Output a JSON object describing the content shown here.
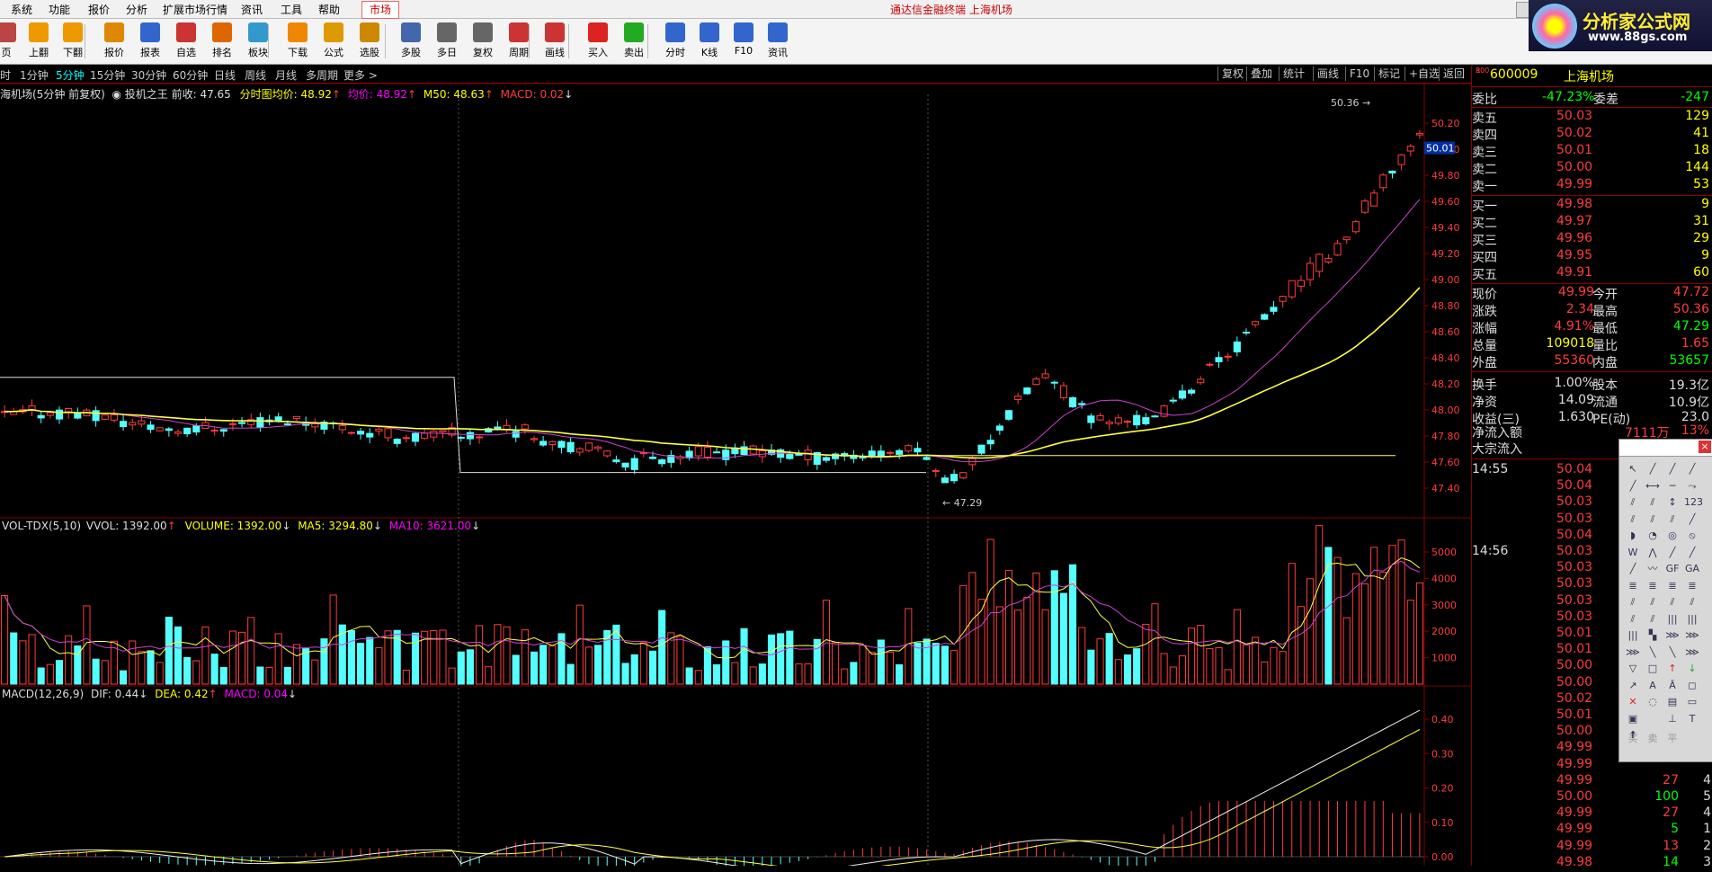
{
  "menubar": {
    "items": [
      "系统",
      "功能",
      "报价",
      "分析",
      "扩展市场行情",
      "资讯",
      "工具",
      "帮助"
    ],
    "market_tab": "市场",
    "app_title": "通达信金融终端  上海机场"
  },
  "toolbar": {
    "buttons": [
      {
        "label": "页",
        "icon": "page-icon",
        "color": "#b44"
      },
      {
        "label": "上翻",
        "icon": "arrow-up-icon",
        "color": "#e90"
      },
      {
        "label": "下翻",
        "icon": "arrow-down-icon",
        "color": "#e90"
      },
      {
        "label": "报价",
        "icon": "yen-icon",
        "color": "#d80"
      },
      {
        "label": "报表",
        "icon": "report-icon",
        "color": "#36c"
      },
      {
        "label": "自选",
        "icon": "f6-key-icon",
        "color": "#c33"
      },
      {
        "label": "排名",
        "icon": "ranking-icon",
        "color": "#d60"
      },
      {
        "label": "板块",
        "icon": "blocks-icon",
        "color": "#39c"
      },
      {
        "label": "下载",
        "icon": "download-icon",
        "color": "#e80"
      },
      {
        "label": "公式",
        "icon": "formula-icon",
        "color": "#d90"
      },
      {
        "label": "选股",
        "icon": "stock-pick-icon",
        "color": "#c80"
      },
      {
        "label": "多股",
        "icon": "multi-stock-icon",
        "color": "#46a"
      },
      {
        "label": "多日",
        "icon": "clock-icon",
        "color": "#666"
      },
      {
        "label": "复权",
        "icon": "restore-icon",
        "color": "#666"
      },
      {
        "label": "周期",
        "icon": "f8-key-icon",
        "color": "#c33"
      },
      {
        "label": "画线",
        "icon": "pencil-icon",
        "color": "#c33"
      },
      {
        "label": "买入",
        "icon": "buy-icon",
        "color": "#d22"
      },
      {
        "label": "卖出",
        "icon": "sell-icon",
        "color": "#2a2"
      },
      {
        "label": "分时",
        "icon": "intraday-icon",
        "color": "#36c"
      },
      {
        "label": "K线",
        "icon": "kline-icon",
        "color": "#36c"
      },
      {
        "label": "F10",
        "icon": "f10-icon",
        "color": "#36c"
      },
      {
        "label": "资讯",
        "icon": "news-icon",
        "color": "#36c"
      }
    ]
  },
  "logo": {
    "title": "分析家公式网",
    "url_text": "www.88gs.com"
  },
  "periods": {
    "items": [
      "时",
      "1分钟",
      "5分钟",
      "15分钟",
      "30分钟",
      "60分钟",
      "日线",
      "周线",
      "月线",
      "多周期",
      "更多"
    ],
    "active": "5分钟",
    "right_tabs": [
      "复权",
      "叠加",
      "统计",
      "画线",
      "F10",
      "标记",
      "+自选",
      "返回"
    ]
  },
  "main_header": {
    "stock": "海机场(5分钟 前复权)",
    "indicator": "投机之王",
    "prev_close": "前收: 47.65",
    "avg_line": "分时图均价: 48.92",
    "avg": "均价: 48.92",
    "m50": "M50: 48.63",
    "macd": "MACD: 0.02"
  },
  "price_axis": [
    "50.20",
    "50.00",
    "49.80",
    "49.60",
    "49.40",
    "49.20",
    "49.00",
    "48.80",
    "48.60",
    "48.40",
    "48.20",
    "48.00",
    "47.80",
    "47.60",
    "47.40"
  ],
  "price_marker": "50.01",
  "high_label": "50.36",
  "low_label": "47.29",
  "vol_header": {
    "name": "VOL-TDX(5,10)",
    "vvol": "VVOL: 1392.00",
    "volume": "VOLUME: 1392.00",
    "ma5": "MA5: 3294.80",
    "ma10": "MA10: 3621.00"
  },
  "vol_axis": [
    "5000",
    "4000",
    "3000",
    "2000",
    "1000"
  ],
  "macd_header": {
    "name": "MACD(12,26,9)",
    "dif": "DIF: 0.44",
    "dea": "DEA: 0.42",
    "macd": "MACD: 0.04"
  },
  "macd_axis": [
    "0.40",
    "0.30",
    "0.20",
    "0.10",
    "0.00"
  ],
  "quote": {
    "code": "600009",
    "name": "上海机场",
    "badge_top": "R",
    "badge_bottom": "300",
    "wb_label": "委比",
    "wb_val": "-47.23%",
    "wc_label": "委差",
    "wc_val": "-247",
    "asks": [
      {
        "label": "卖五",
        "price": "50.03",
        "vol": "129"
      },
      {
        "label": "卖四",
        "price": "50.02",
        "vol": "41"
      },
      {
        "label": "卖三",
        "price": "50.01",
        "vol": "18"
      },
      {
        "label": "卖二",
        "price": "50.00",
        "vol": "144"
      },
      {
        "label": "卖一",
        "price": "49.99",
        "vol": "53"
      }
    ],
    "bids": [
      {
        "label": "买一",
        "price": "49.98",
        "vol": "9"
      },
      {
        "label": "买二",
        "price": "49.97",
        "vol": "31"
      },
      {
        "label": "买三",
        "price": "49.96",
        "vol": "29"
      },
      {
        "label": "买四",
        "price": "49.95",
        "vol": "9"
      },
      {
        "label": "买五",
        "price": "49.91",
        "vol": "60"
      }
    ],
    "stats": [
      {
        "l1": "现价",
        "v1": "49.99",
        "c1": "red",
        "l2": "今开",
        "v2": "47.72",
        "c2": "red"
      },
      {
        "l1": "涨跌",
        "v1": "2.34",
        "c1": "red",
        "l2": "最高",
        "v2": "50.36",
        "c2": "red"
      },
      {
        "l1": "涨幅",
        "v1": "4.91%",
        "c1": "red",
        "l2": "最低",
        "v2": "47.29",
        "c2": "grn"
      },
      {
        "l1": "总量",
        "v1": "109018",
        "c1": "yel",
        "l2": "量比",
        "v2": "1.65",
        "c2": "red"
      },
      {
        "l1": "外盘",
        "v1": "55360",
        "c1": "red",
        "l2": "内盘",
        "v2": "53657",
        "c2": "grn"
      },
      {
        "l1": "换手",
        "v1": "1.00%",
        "c1": "wht",
        "l2": "股本",
        "v2": "19.3亿",
        "c2": "wht"
      },
      {
        "l1": "净资",
        "v1": "14.09",
        "c1": "wht",
        "l2": "流通",
        "v2": "10.9亿",
        "c2": "wht"
      },
      {
        "l1": "收益(三)",
        "v1": "1.630",
        "c1": "wht",
        "l2": "PE(动)",
        "v2": "23.0",
        "c2": "wht"
      }
    ],
    "flow": [
      {
        "label": "净流入额",
        "val": "7111万",
        "val2": "13%"
      },
      {
        "label": "大宗流入",
        "val": "",
        "val2": ""
      }
    ],
    "ticks": [
      {
        "time": "14:55",
        "price": "50.04",
        "vol": "",
        "d": ""
      },
      {
        "time": "",
        "price": "50.04",
        "vol": "",
        "d": ""
      },
      {
        "time": "",
        "price": "50.03",
        "vol": "",
        "d": ""
      },
      {
        "time": "",
        "price": "50.03",
        "vol": "",
        "d": ""
      },
      {
        "time": "",
        "price": "50.04",
        "vol": "",
        "d": ""
      },
      {
        "time": "14:56",
        "price": "50.03",
        "vol": "",
        "d": ""
      },
      {
        "time": "",
        "price": "50.03",
        "vol": "",
        "d": ""
      },
      {
        "time": "",
        "price": "50.03",
        "vol": "",
        "d": ""
      },
      {
        "time": "",
        "price": "50.03",
        "vol": "",
        "d": ""
      },
      {
        "time": "",
        "price": "50.03",
        "vol": "",
        "d": ""
      },
      {
        "time": "",
        "price": "50.01",
        "vol": "",
        "d": ""
      },
      {
        "time": "",
        "price": "50.01",
        "vol": "",
        "d": ""
      },
      {
        "time": "",
        "price": "50.00",
        "vol": "",
        "d": ""
      },
      {
        "time": "",
        "price": "50.00",
        "vol": "",
        "d": ""
      },
      {
        "time": "",
        "price": "50.02",
        "vol": "",
        "d": ""
      },
      {
        "time": "",
        "price": "50.01",
        "vol": "",
        "d": ""
      },
      {
        "time": "",
        "price": "50.00",
        "vol": "",
        "d": ""
      },
      {
        "time": "",
        "price": "49.99",
        "vol": "",
        "d": ""
      },
      {
        "time": "",
        "price": "49.99",
        "vol": "",
        "d": ""
      },
      {
        "time": "",
        "price": "49.99",
        "vol": "27",
        "d": "4"
      },
      {
        "time": "",
        "price": "50.00",
        "vol": "100",
        "d": "5"
      },
      {
        "time": "",
        "price": "49.99",
        "vol": "27",
        "d": "4"
      },
      {
        "time": "",
        "price": "49.99",
        "vol": "5",
        "d": "1"
      },
      {
        "time": "",
        "price": "49.99",
        "vol": "13",
        "d": "2"
      },
      {
        "time": "",
        "price": "49.98",
        "vol": "14",
        "d": "3"
      }
    ]
  },
  "drawing_tools": {
    "bottom": [
      "买",
      "卖",
      "平"
    ]
  },
  "colors": {
    "up": "#ff3c3c",
    "down": "#54ffff",
    "ma_yellow": "#ffff40",
    "ma_purple": "#d040d0",
    "grid_red": "#800000"
  }
}
